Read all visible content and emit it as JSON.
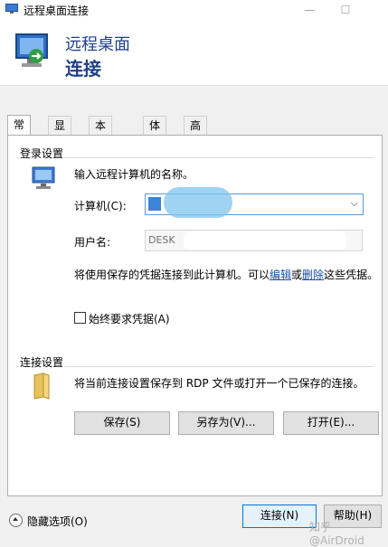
{
  "window": {
    "title": "远程桌面连接",
    "min_glyph": "—",
    "max_glyph": "☐"
  },
  "header": {
    "line1": "远程桌面",
    "line2": "连接"
  },
  "tabs": [
    {
      "label": "常规"
    },
    {
      "label": "显示"
    },
    {
      "label": "本地资源"
    },
    {
      "label": "体验"
    },
    {
      "label": "高级"
    }
  ],
  "logon": {
    "group_label": "登录设置",
    "prompt": "输入远程计算机的名称。",
    "computer_label": "计算机(C):",
    "computer_value": "",
    "username_label": "用户名:",
    "username_value": "DESK",
    "saved_text_before": "将使用保存的凭据连接到此计算机。可以",
    "edit_link": "编辑",
    "or_text": "或",
    "delete_link": "删除",
    "saved_text_after": "这些凭据。",
    "always_ask_label": "始终要求凭据(A)"
  },
  "connection": {
    "group_label": "连接设置",
    "description": "将当前连接设置保存到 RDP 文件或打开一个已保存的连接。",
    "save_label": "保存(S)",
    "save_as_label": "另存为(V)...",
    "open_label": "打开(E)..."
  },
  "footer": {
    "hide_options_label": "隐藏选项(O)",
    "connect_label": "连接(N)",
    "help_label": "帮助(H)",
    "watermark": "知乎 @AirDroid"
  }
}
